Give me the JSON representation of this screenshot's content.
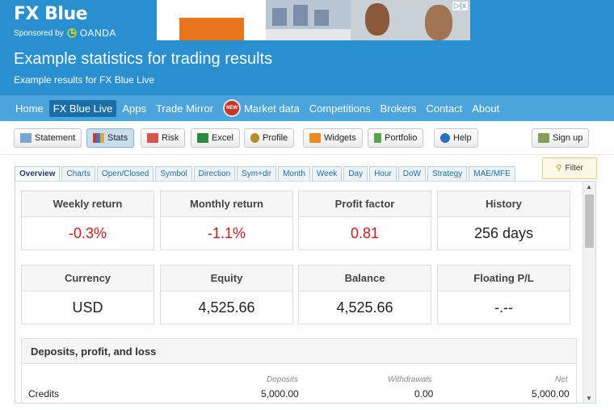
{
  "header": {
    "logo": "FX Blue",
    "sponsored_by": "Sponsored by",
    "sponsor_name": "OANDA",
    "page_title": "Example statistics for trading results",
    "page_subtitle": "Example results for FX Blue Live",
    "ad_close": "▷|x"
  },
  "nav": {
    "home": "Home",
    "fxbluelive": "FX Blue Live",
    "apps": "Apps",
    "trademirror": "Trade Mirror",
    "new_badge": "NEW",
    "marketdata": "Market data",
    "competitions": "Competitions",
    "brokers": "Brokers",
    "contact": "Contact",
    "about": "About"
  },
  "toolbar": {
    "statement": "Statement",
    "stats": "Stats",
    "risk": "Risk",
    "excel": "Excel",
    "profile": "Profile",
    "widgets": "Widgets",
    "portfolio": "Portfolio",
    "help": "Help",
    "signup": "Sign up"
  },
  "tabs": [
    "Overview",
    "Charts",
    "Open/Closed",
    "Symbol",
    "Direction",
    "Sym+dir",
    "Month",
    "Week",
    "Day",
    "Hour",
    "DoW",
    "Strategy",
    "MAE/MFE"
  ],
  "filter_label": "Filter",
  "cards": {
    "weekly": {
      "label": "Weekly return",
      "value": "-0.3%"
    },
    "monthly": {
      "label": "Monthly return",
      "value": "-1.1%"
    },
    "profit_factor": {
      "label": "Profit factor",
      "value": "0.81"
    },
    "history": {
      "label": "History",
      "value": "256 days"
    },
    "currency": {
      "label": "Currency",
      "value": "USD"
    },
    "equity": {
      "label": "Equity",
      "value": "4,525.66"
    },
    "balance": {
      "label": "Balance",
      "value": "4,525.66"
    },
    "floating": {
      "label": "Floating P/L",
      "value": "-.--"
    }
  },
  "dpl": {
    "title": "Deposits, profit, and loss",
    "col_deposits": "Deposits",
    "col_withdrawals": "Withdrawals",
    "col_net": "Net",
    "row_label": "Credits",
    "row_deposits": "5,000.00",
    "row_withdrawals": "0.00",
    "row_net": "5,000.00"
  },
  "colors": {
    "header_blue": "#2a8fcf",
    "nav_blue": "#4ba5dc",
    "active_nav": "#1a6ea8",
    "negative_red": "#c41e1e"
  }
}
